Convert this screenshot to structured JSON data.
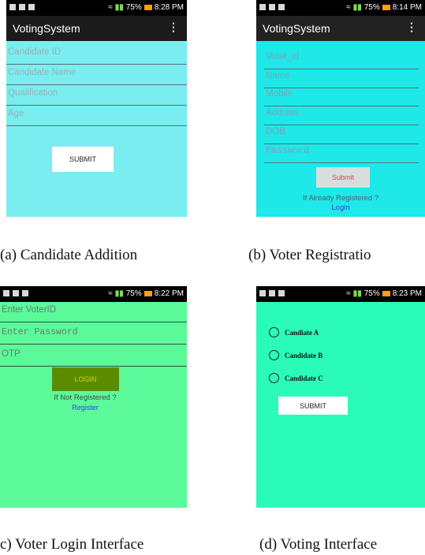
{
  "panel_a": {
    "status_time": "8:28 PM",
    "battery": "75%",
    "app_title": "VotingSystem",
    "fields": [
      "Candidate ID",
      "Candidate Name",
      "Qualification",
      "Age"
    ],
    "submit_label": "SUBMIT",
    "caption": "(a) Candidate Addition",
    "colors": {
      "background": "#7aedf0",
      "appbar": "#1b1b1b"
    }
  },
  "panel_b": {
    "status_time": "8:14 PM",
    "battery": "75%",
    "app_title": "VotingSystem",
    "fields": [
      "Voter_id",
      "Name",
      "Mobile",
      "Address",
      "DOB",
      "Password"
    ],
    "submit_label": "Submit",
    "already_registered": "If Already Registered ?",
    "login_link": "Login",
    "caption": "(b) Voter Registratio",
    "colors": {
      "background": "#1ee8e8",
      "submit_text": "#e2473c",
      "link": "#2b49d9"
    }
  },
  "panel_c": {
    "status_time": "8:22 PM",
    "battery": "75%",
    "fields": [
      "Enter VoterID",
      "Enter Password",
      "OTP"
    ],
    "login_label": "LOGIN",
    "not_registered": "If Not Registered ?",
    "register_link": "Register",
    "caption": "c) Voter Login Interface",
    "colors": {
      "background": "#5bf99a",
      "login_button": "#5b8c00"
    }
  },
  "panel_d": {
    "status_time": "8:23 PM",
    "battery": "75%",
    "candidates": [
      "Candiate A",
      "Candidate B",
      "Candidate C"
    ],
    "submit_label": "SUBMIT",
    "caption": "(d) Voting Interface",
    "colors": {
      "background": "#2afcb8"
    }
  }
}
